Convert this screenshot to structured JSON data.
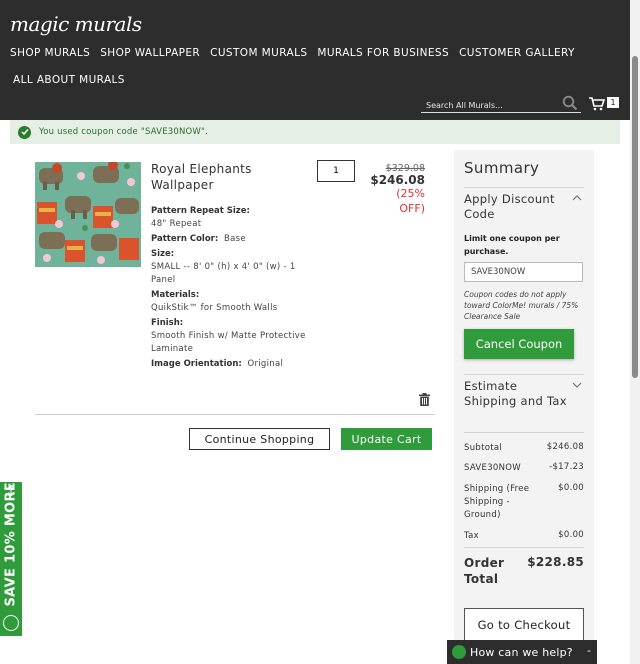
{
  "header": {
    "logo": "magic murals",
    "nav_row1": [
      "SHOP MURALS",
      "SHOP WALLPAPER",
      "CUSTOM MURALS",
      "MURALS FOR BUSINESS",
      "CUSTOMER GALLERY"
    ],
    "nav_row2": [
      "ALL ABOUT MURALS"
    ],
    "search_placeholder": "Search All Murals...",
    "cart_count": "1"
  },
  "notice": {
    "text": "You used coupon code \"SAVE30NOW\"."
  },
  "cart_item": {
    "name": "Royal Elephants Wallpaper",
    "quantity": "1",
    "price_old": "$329.08",
    "price_new": "$246.08",
    "discount": "(25% OFF)",
    "options": {
      "pattern_repeat_label": "Pattern Repeat Size:",
      "pattern_repeat_value": "48\" Repeat",
      "pattern_color_label": "Pattern Color:",
      "pattern_color_value": "Base",
      "size_label": "Size:",
      "size_value": "SMALL -- 8' 0\" (h) x 4' 0\" (w) - 1 Panel",
      "materials_label": "Materials:",
      "materials_value": "QuikStik™ for Smooth Walls",
      "finish_label": "Finish:",
      "finish_value": "Smooth Finish w/ Matte Protective Laminate",
      "orientation_label": "Image Orientation:",
      "orientation_value": "Original"
    }
  },
  "actions": {
    "continue": "Continue Shopping",
    "update": "Update Cart"
  },
  "summary": {
    "title": "Summary",
    "discount_title": "Apply Discount Code",
    "limit_note": "Limit one coupon per purchase.",
    "coupon_value": "SAVE30NOW",
    "coupon_note": "Coupon codes do not apply toward ColorMe! murals / 75% Clearance Sale",
    "cancel_coupon": "Cancel Coupon",
    "shipping_title": "Estimate Shipping and Tax",
    "rows": {
      "subtotal_label": "Subtotal",
      "subtotal_value": "$246.08",
      "coupon_label": "SAVE30NOW",
      "coupon_value": "-$17.23",
      "shipping_label": "Shipping (Free Shipping - Ground)",
      "shipping_value": "$0.00",
      "tax_label": "Tax",
      "tax_value": "$0.00",
      "total_label": "Order Total",
      "total_value": "$228.85"
    },
    "checkout": "Go to Checkout"
  },
  "save_tab": {
    "text": "SAVE 10% MORE!"
  },
  "chat": {
    "text": "How can we help?",
    "minimize": "-"
  },
  "colors": {
    "header_bg": "#2d2d2d",
    "accent_green": "#2f9b3a",
    "discount_red": "#e03030",
    "notice_bg": "#e5efe5"
  }
}
